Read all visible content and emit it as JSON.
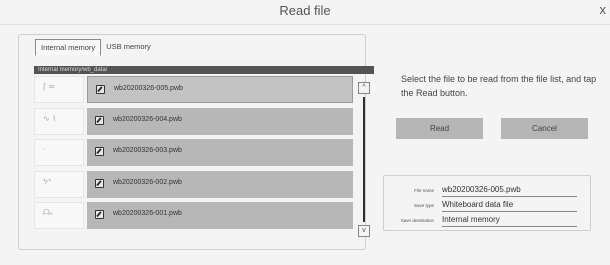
{
  "window": {
    "title": "Read file",
    "close_glyph": "x"
  },
  "tabs": [
    {
      "label": "Internal memory",
      "active": true
    },
    {
      "label": "USB memory",
      "active": false
    }
  ],
  "path": "Internal memory/wb_data/",
  "files": [
    {
      "name": "wb20200326-005.pwb",
      "preview": "ʃ ≈",
      "selected": true
    },
    {
      "name": "wb20200326-004.pwb",
      "preview": "∿ ⌇",
      "selected": false
    },
    {
      "name": "wb20200326-003.pwb",
      "preview": "·",
      "selected": false
    },
    {
      "name": "wb20200326-002.pwb",
      "preview": "ᔭᕐ",
      "selected": false
    },
    {
      "name": "wb20200326-001.pwb",
      "preview": "ᗩₙ",
      "selected": false
    }
  ],
  "scrollbar": {
    "up_glyph": "^",
    "down_glyph": "v"
  },
  "instruction": "Select the file to be read from the file list, and tap the Read button.",
  "buttons": {
    "read": "Read",
    "cancel": "Cancel"
  },
  "info": {
    "file_name_label": "File name",
    "file_name_value": "wb20200326-005.pwb",
    "save_type_label": "Save type",
    "save_type_value": "Whiteboard data file",
    "save_destination_label": "Save destination",
    "save_destination_value": "Internal memory"
  },
  "colors": {
    "file_row_bg": "#b7b7b7",
    "path_bar_bg": "#545454",
    "button_bg": "#b5b5b5"
  }
}
